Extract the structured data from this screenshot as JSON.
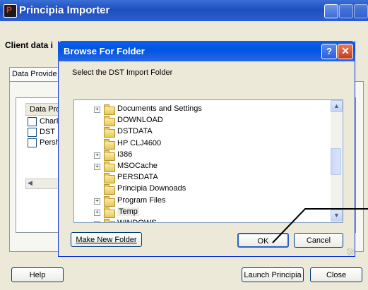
{
  "main_window": {
    "title": "Principia Importer",
    "client_label": "Client data i",
    "tab_label": "Data Provide",
    "list_header": "Data Pro",
    "providers": [
      {
        "label": "Charl",
        "checked": false
      },
      {
        "label": "DST",
        "checked": false
      },
      {
        "label": "Persh",
        "checked": false
      }
    ],
    "buttons": {
      "help": "Help",
      "launch": "Launch Principia",
      "close": "Close"
    }
  },
  "dialog": {
    "title": "Browse For Folder",
    "help_glyph": "?",
    "close_glyph": "✕",
    "prompt": "Select the DST Import Folder",
    "folders": [
      {
        "label": "Documents and Settings",
        "expandable": true
      },
      {
        "label": "DOWNLOAD",
        "expandable": false
      },
      {
        "label": "DSTDATA",
        "expandable": false
      },
      {
        "label": "HP CLJ4600",
        "expandable": false
      },
      {
        "label": "I386",
        "expandable": true
      },
      {
        "label": "MSOCache",
        "expandable": true
      },
      {
        "label": "PERSDATA",
        "expandable": false
      },
      {
        "label": "Principia Downoads",
        "expandable": false
      },
      {
        "label": "Program Files",
        "expandable": true
      },
      {
        "label": "Temp",
        "expandable": true,
        "selected": true
      },
      {
        "label": "WINDOWS",
        "expandable": true
      }
    ],
    "buttons": {
      "make_new_folder": "Make New Folder",
      "ok": "OK",
      "cancel": "Cancel"
    }
  },
  "colors": {
    "title_blue": "#0054e3",
    "selection": "#ecebe6",
    "annotation": "#000000"
  }
}
